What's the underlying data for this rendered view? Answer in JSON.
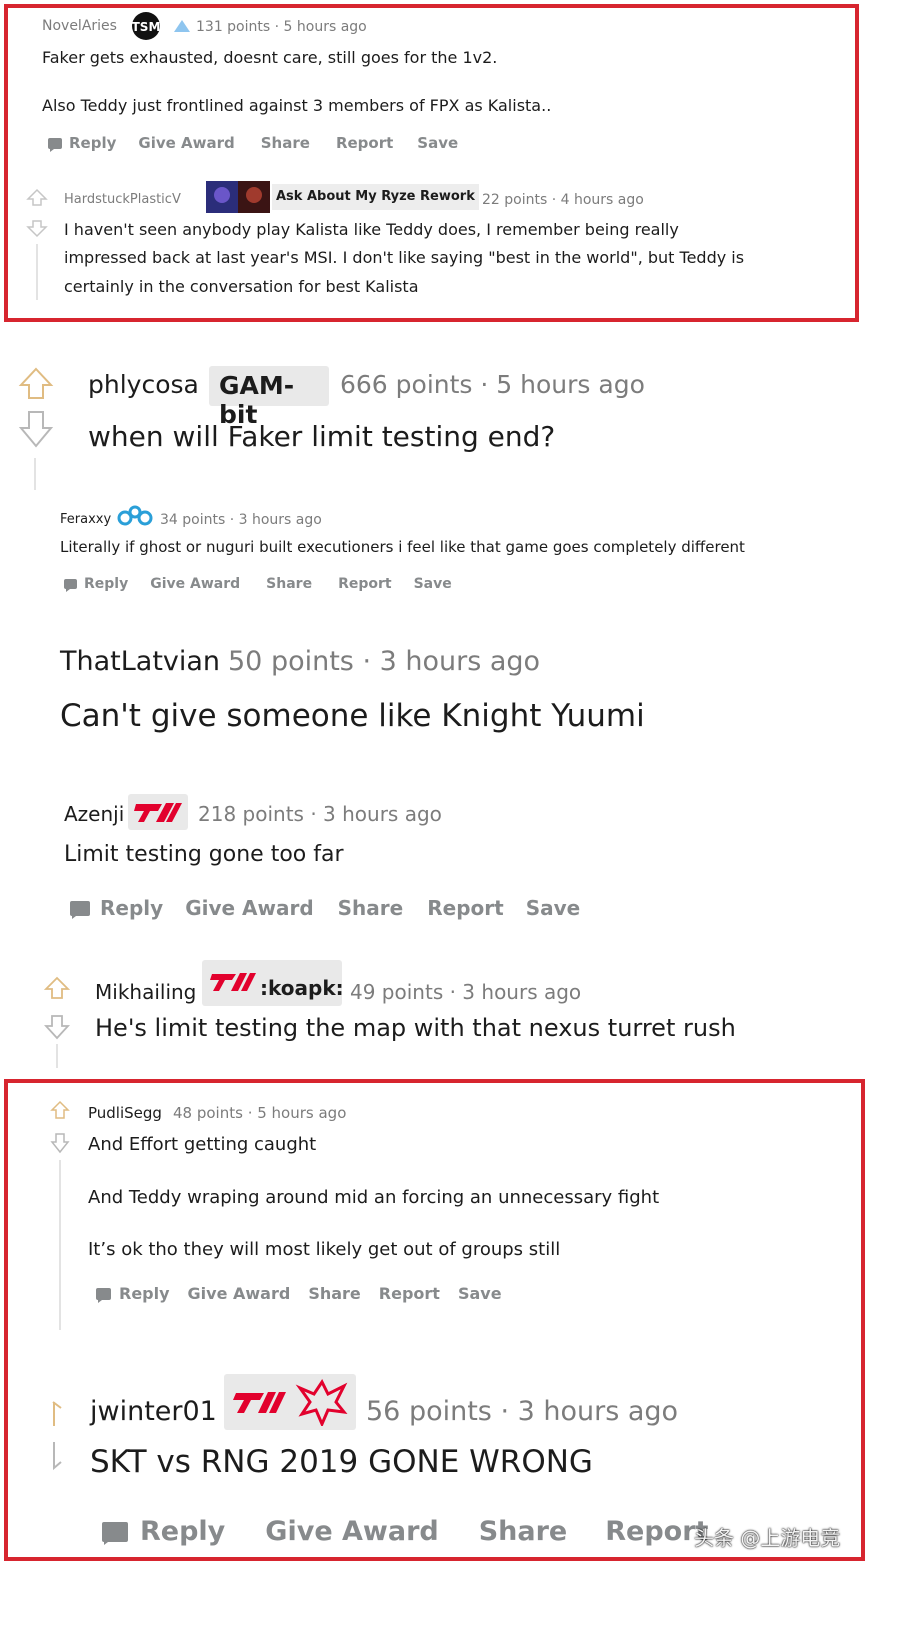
{
  "actions": {
    "reply": "Reply",
    "give_award": "Give Award",
    "share": "Share",
    "report": "Report",
    "save": "Save"
  },
  "c1": {
    "user": "NovelAries",
    "flair": "TSM",
    "meta": "131 points · 5 hours ago",
    "line1": "Faker gets exhausted, doesnt care, still goes for the 1v2.",
    "line2": "Also Teddy just frontlined against 3 members of FPX as Kalista.."
  },
  "c2": {
    "user": "HardstuckPlasticV",
    "flair": "Ask About My Ryze Rework",
    "meta": "22 points · 4 hours ago",
    "line1": "I haven't seen anybody play Kalista like Teddy does, I remember being really",
    "line2": "impressed back at last year's MSI. I don't like saying \"best in the world\", but Teddy is",
    "line3": "certainly in the conversation for best Kalista"
  },
  "c3": {
    "user": "phlycosa",
    "flair": "GAM-bit",
    "meta": "666 points · 5 hours ago",
    "line1": "when will Faker limit testing end?"
  },
  "c4": {
    "user": "Feraxxy",
    "meta": "34 points · 3 hours ago",
    "line1": "Literally if ghost or nuguri built executioners i feel like that game goes completely different"
  },
  "c5": {
    "user": "ThatLatvian",
    "meta": "50 points · 3 hours ago",
    "line1": "Can't give someone like Knight Yuumi"
  },
  "c6": {
    "user": "Azenji",
    "meta": "218 points · 3 hours ago",
    "line1": "Limit testing gone too far"
  },
  "c7": {
    "user": "Mikhailing",
    "flair": ":koapk:",
    "meta": "49 points · 3 hours ago",
    "line1": "He's limit testing the map with that nexus turret rush"
  },
  "c8": {
    "user": "PudliSegg",
    "meta": "48 points · 5 hours ago",
    "line1": "And Effort getting caught",
    "line2": "And Teddy wraping around mid an forcing an unnecessary fight",
    "line3": "It’s ok tho they will most likely get out of groups still"
  },
  "c9": {
    "user": "jwinter01",
    "meta": "56 points · 3 hours ago",
    "line1": "SKT vs RNG 2019 GONE WRONG"
  },
  "watermark": "头条 @上游电竞",
  "colors": {
    "highlight_border": "#d7252f",
    "t1_red": "#e2012d",
    "muted_text": "#7c7c7c",
    "action_gray": "#878a8c",
    "c9_blue": "#1d8fe1"
  }
}
